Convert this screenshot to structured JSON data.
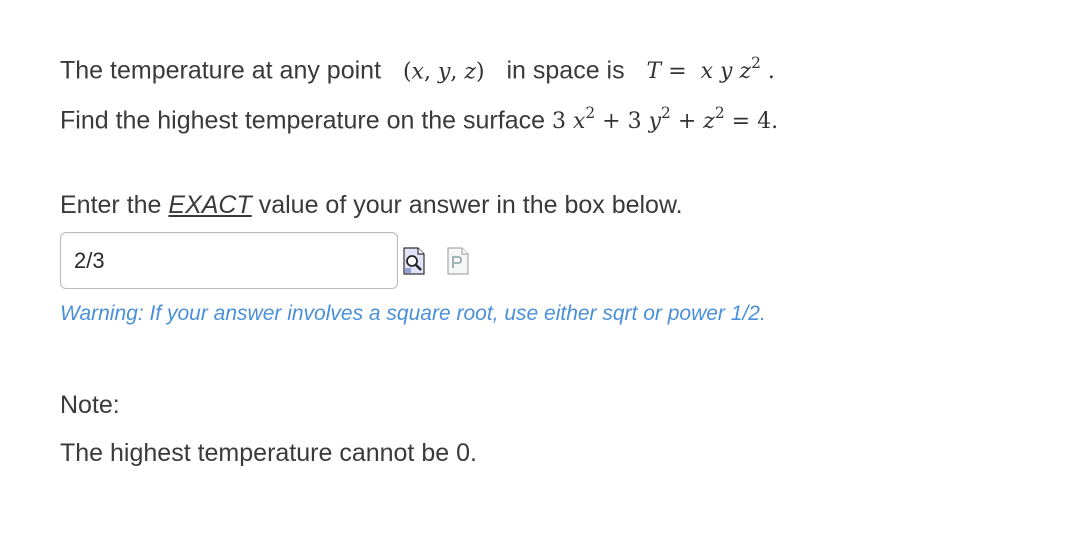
{
  "problem": {
    "line1_text": "The temperature at any point",
    "line1_mid": "in space is",
    "line2_text": "Find the highest temperature on the surface",
    "instruction_before": "Enter the",
    "instruction_exact": "EXACT",
    "instruction_after": "value of your answer in the box below."
  },
  "answer": {
    "value": "2/3"
  },
  "icons": {
    "preview": "preview-answer-icon",
    "format": "format-help-icon"
  },
  "warning": "Warning: If your answer involves a square root, use either sqrt or power 1/2.",
  "note": {
    "label": "Note:",
    "text": "The highest temperature cannot be 0."
  }
}
